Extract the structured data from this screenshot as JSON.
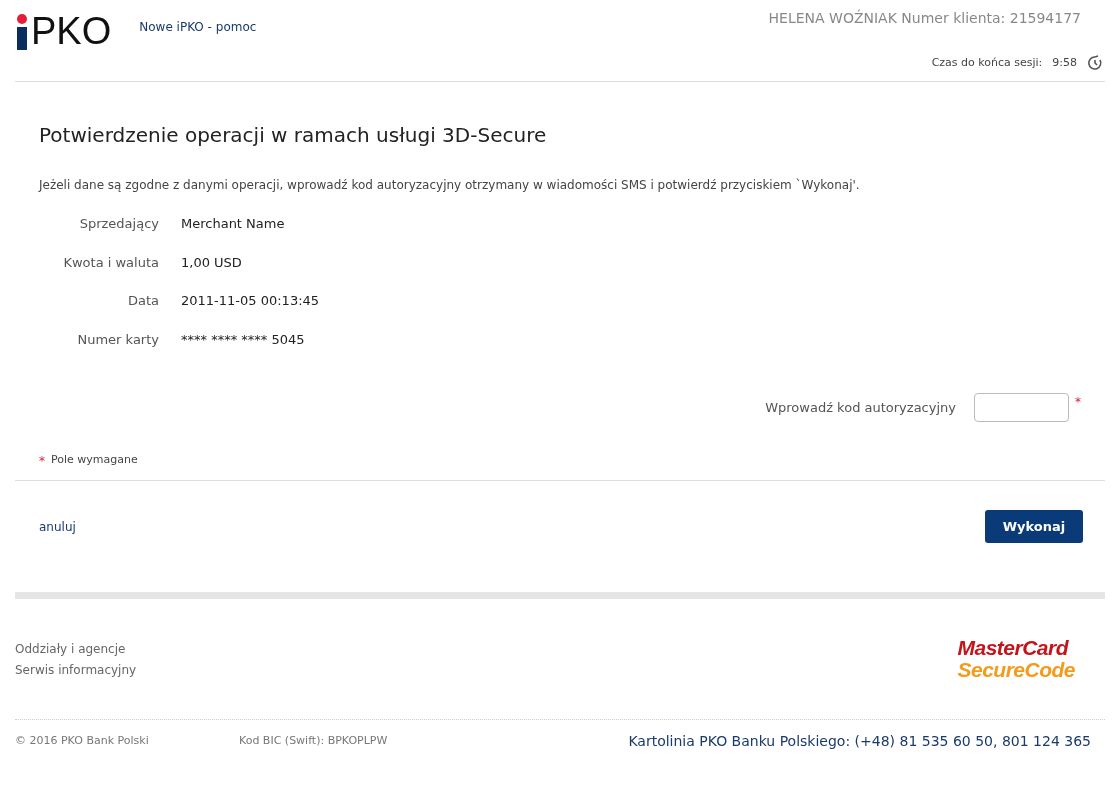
{
  "header": {
    "logo": "PKO",
    "help_link": "Nowe iPKO - pomoc",
    "user": "HELENA WOŹNIAK Numer klienta: 21594177",
    "session_label": "Czas do końca sesji:",
    "session_time": "9:58"
  },
  "title": "Potwierdzenie operacji w ramach usługi 3D-Secure",
  "intro": "Jeżeli dane są zgodne z danymi operacji, wprowadź kod autoryzacyjny otrzymany w wiadomości SMS i potwierdź przyciskiem `Wykonaj'.",
  "details": [
    {
      "label": "Sprzedający",
      "value": "Merchant Name"
    },
    {
      "label": "Kwota i waluta",
      "value": "1,00 USD"
    },
    {
      "label": "Data",
      "value": "2011-11-05 00:13:45"
    },
    {
      "label": "Numer karty",
      "value": "**** **** **** 5045"
    }
  ],
  "code_field": {
    "label": "Wprowadź kod autoryzacyjny",
    "required_mark": "*"
  },
  "required_note": {
    "mark": "*",
    "text": "Pole wymagane"
  },
  "cancel_link": "anuluj",
  "submit_button": "Wykonaj",
  "footer": {
    "links": [
      "Oddziały i agencje",
      "Serwis informacyjny"
    ],
    "badge": {
      "line1": "MasterCard",
      "line2": "SecureCode"
    },
    "copyright": "© 2016 PKO Bank Polski",
    "bic": "Kod BIC (Swift): BPKOPLPW",
    "hotline": "Kartolinia PKO Banku Polskiego: (+48) 81 535 60 50, 801 124 365"
  }
}
